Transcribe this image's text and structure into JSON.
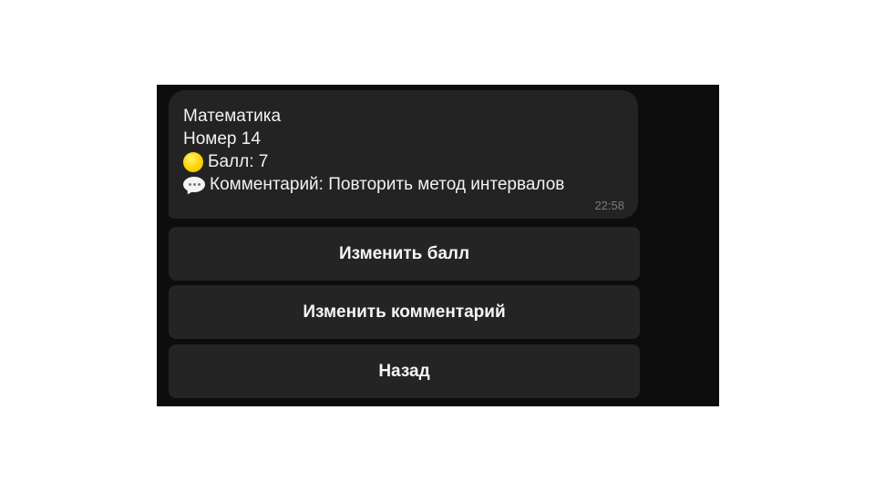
{
  "message": {
    "subject": "Математика",
    "number": "Номер 14",
    "score_icon": "yellow-circle-icon",
    "score": "Балл: 7",
    "comment_icon": "speech-balloon-icon",
    "comment": "Комментарий: Повторить метод интервалов",
    "time": "22:58"
  },
  "buttons": {
    "change_score": "Изменить балл",
    "change_comment": "Изменить комментарий",
    "back": "Назад"
  },
  "colors": {
    "panel_background": "#0d0d0d",
    "bubble_background": "#232323",
    "button_background": "#242424",
    "text": "#f2f2f2",
    "time_text": "#7b7b7b",
    "score_circle": "#ffd200"
  }
}
